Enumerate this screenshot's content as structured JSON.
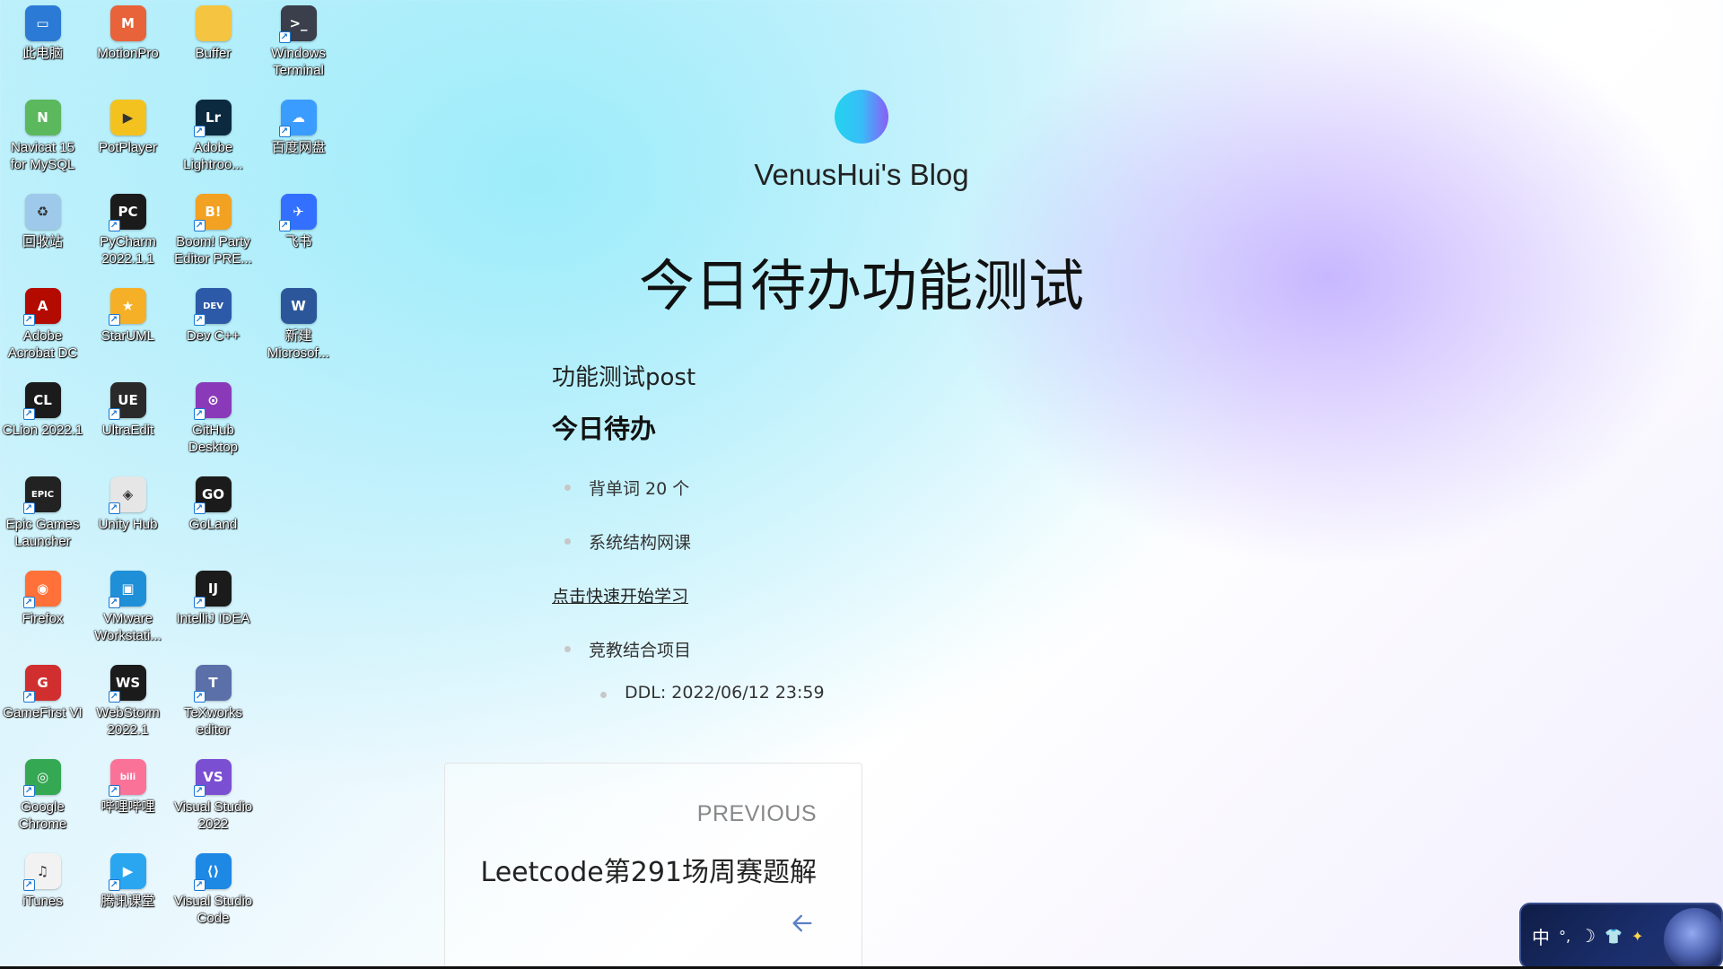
{
  "desktop": {
    "icons": [
      {
        "label": "此电脑",
        "icon": "computer-icon",
        "color": "#2b7bd6",
        "glyph": "▭",
        "shortcut": false
      },
      {
        "label": "MotionPro",
        "icon": "motionpro-icon",
        "color": "#e8633a",
        "glyph": "M",
        "shortcut": false
      },
      {
        "label": "Buffer",
        "icon": "folder-icon",
        "color": "#f5c542",
        "glyph": "",
        "shortcut": false
      },
      {
        "label": "Windows Terminal",
        "icon": "terminal-icon",
        "color": "#3a3f4b",
        "glyph": ">_",
        "shortcut": true
      },
      {
        "label": "Navicat 15 for MySQL",
        "icon": "navicat-icon",
        "color": "#5cb85c",
        "glyph": "N",
        "shortcut": false
      },
      {
        "label": "PotPlayer",
        "icon": "potplayer-icon",
        "color": "#f4c21f",
        "glyph": "▶",
        "shortcut": false
      },
      {
        "label": "Adobe Lightroo...",
        "icon": "lightroom-icon",
        "color": "#0b2a3f",
        "glyph": "Lr",
        "shortcut": true
      },
      {
        "label": "百度网盘",
        "icon": "baidu-netdisk-icon",
        "color": "#3b9cff",
        "glyph": "☁",
        "shortcut": true
      },
      {
        "label": "回收站",
        "icon": "recycle-bin-icon",
        "color": "#9ec9ea",
        "glyph": "♻",
        "shortcut": false
      },
      {
        "label": "PyCharm 2022.1.1",
        "icon": "pycharm-icon",
        "color": "#1b1b1b",
        "glyph": "PC",
        "shortcut": true
      },
      {
        "label": "Boom! Party Editor PRE...",
        "icon": "boom-party-icon",
        "color": "#f2a122",
        "glyph": "B!",
        "shortcut": true
      },
      {
        "label": "飞书",
        "icon": "feishu-icon",
        "color": "#3370ff",
        "glyph": "✈",
        "shortcut": true
      },
      {
        "label": "Adobe Acrobat DC",
        "icon": "acrobat-icon",
        "color": "#b30b00",
        "glyph": "A",
        "shortcut": true
      },
      {
        "label": "StarUML",
        "icon": "staruml-icon",
        "color": "#f5b027",
        "glyph": "★",
        "shortcut": true
      },
      {
        "label": "Dev C++",
        "icon": "devcpp-icon",
        "color": "#2d5aa8",
        "glyph": "DEV",
        "shortcut": true
      },
      {
        "label": "新建 Microsof...",
        "icon": "word-icon",
        "color": "#2b579a",
        "glyph": "W",
        "shortcut": false
      },
      {
        "label": "CLion 2022.1",
        "icon": "clion-icon",
        "color": "#1b1b1b",
        "glyph": "CL",
        "shortcut": true
      },
      {
        "label": "UltraEdit",
        "icon": "ultraedit-icon",
        "color": "#2a2a2a",
        "glyph": "UE",
        "shortcut": true
      },
      {
        "label": "GitHub Desktop",
        "icon": "github-desktop-icon",
        "color": "#8a3ab9",
        "glyph": "⊙",
        "shortcut": true
      },
      {
        "label": "",
        "icon": "",
        "color": "",
        "glyph": "",
        "shortcut": false
      },
      {
        "label": "Epic Games Launcher",
        "icon": "epic-games-icon",
        "color": "#222222",
        "glyph": "EPIC",
        "shortcut": true
      },
      {
        "label": "Unity Hub",
        "icon": "unity-hub-icon",
        "color": "#e6e6e6",
        "glyph": "◈",
        "shortcut": true
      },
      {
        "label": "GoLand",
        "icon": "goland-icon",
        "color": "#1b1b1b",
        "glyph": "GO",
        "shortcut": true
      },
      {
        "label": "",
        "icon": "",
        "color": "",
        "glyph": "",
        "shortcut": false
      },
      {
        "label": "Firefox",
        "icon": "firefox-icon",
        "color": "#ff7139",
        "glyph": "◉",
        "shortcut": true
      },
      {
        "label": "VMware Workstati...",
        "icon": "vmware-icon",
        "color": "#1f8fd8",
        "glyph": "▣",
        "shortcut": true
      },
      {
        "label": "IntelliJ IDEA",
        "icon": "intellij-idea-icon",
        "color": "#1b1b1b",
        "glyph": "IJ",
        "shortcut": true
      },
      {
        "label": "",
        "icon": "",
        "color": "",
        "glyph": "",
        "shortcut": false
      },
      {
        "label": "GameFirst VI",
        "icon": "gamefirst-icon",
        "color": "#d12f2f",
        "glyph": "G",
        "shortcut": true
      },
      {
        "label": "WebStorm 2022.1",
        "icon": "webstorm-icon",
        "color": "#1b1b1b",
        "glyph": "WS",
        "shortcut": true
      },
      {
        "label": "TeXworks editor",
        "icon": "texworks-icon",
        "color": "#5b6fa8",
        "glyph": "T",
        "shortcut": true
      },
      {
        "label": "",
        "icon": "",
        "color": "",
        "glyph": "",
        "shortcut": false
      },
      {
        "label": "Google Chrome",
        "icon": "chrome-icon",
        "color": "#34a853",
        "glyph": "◎",
        "shortcut": true
      },
      {
        "label": "哔哩哔哩",
        "icon": "bilibili-icon",
        "color": "#fb7299",
        "glyph": "bili",
        "shortcut": true
      },
      {
        "label": "Visual Studio 2022",
        "icon": "visual-studio-icon",
        "color": "#7b4fd1",
        "glyph": "VS",
        "shortcut": true
      },
      {
        "label": "",
        "icon": "",
        "color": "",
        "glyph": "",
        "shortcut": false
      },
      {
        "label": "iTunes",
        "icon": "itunes-icon",
        "color": "#f2f2f2",
        "glyph": "♫",
        "shortcut": true
      },
      {
        "label": "腾讯课堂",
        "icon": "tencent-classroom-icon",
        "color": "#2aa6f0",
        "glyph": "▶",
        "shortcut": true
      },
      {
        "label": "Visual Studio Code",
        "icon": "vscode-icon",
        "color": "#1e88e5",
        "glyph": "⟨⟩",
        "shortcut": true
      },
      {
        "label": "",
        "icon": "",
        "color": "",
        "glyph": "",
        "shortcut": false
      }
    ]
  },
  "blog": {
    "site_title": "VenusHui's Blog",
    "post_title": "今日待办功能测试",
    "subtitle": "功能测试post",
    "section_heading": "今日待办",
    "items": {
      "item1": "背单词 20 个",
      "item2": "系统结构网课",
      "link": "点击快速开始学习",
      "item3": "竞教结合项目",
      "subitem": "DDL: 2022/06/12 23:59"
    },
    "prev": {
      "label": "PREVIOUS",
      "title": "Leetcode第291场周赛题解"
    }
  },
  "ime": {
    "mode": "中",
    "punct": "°,",
    "moon": "☽",
    "skin": "👕",
    "star": "✦"
  }
}
